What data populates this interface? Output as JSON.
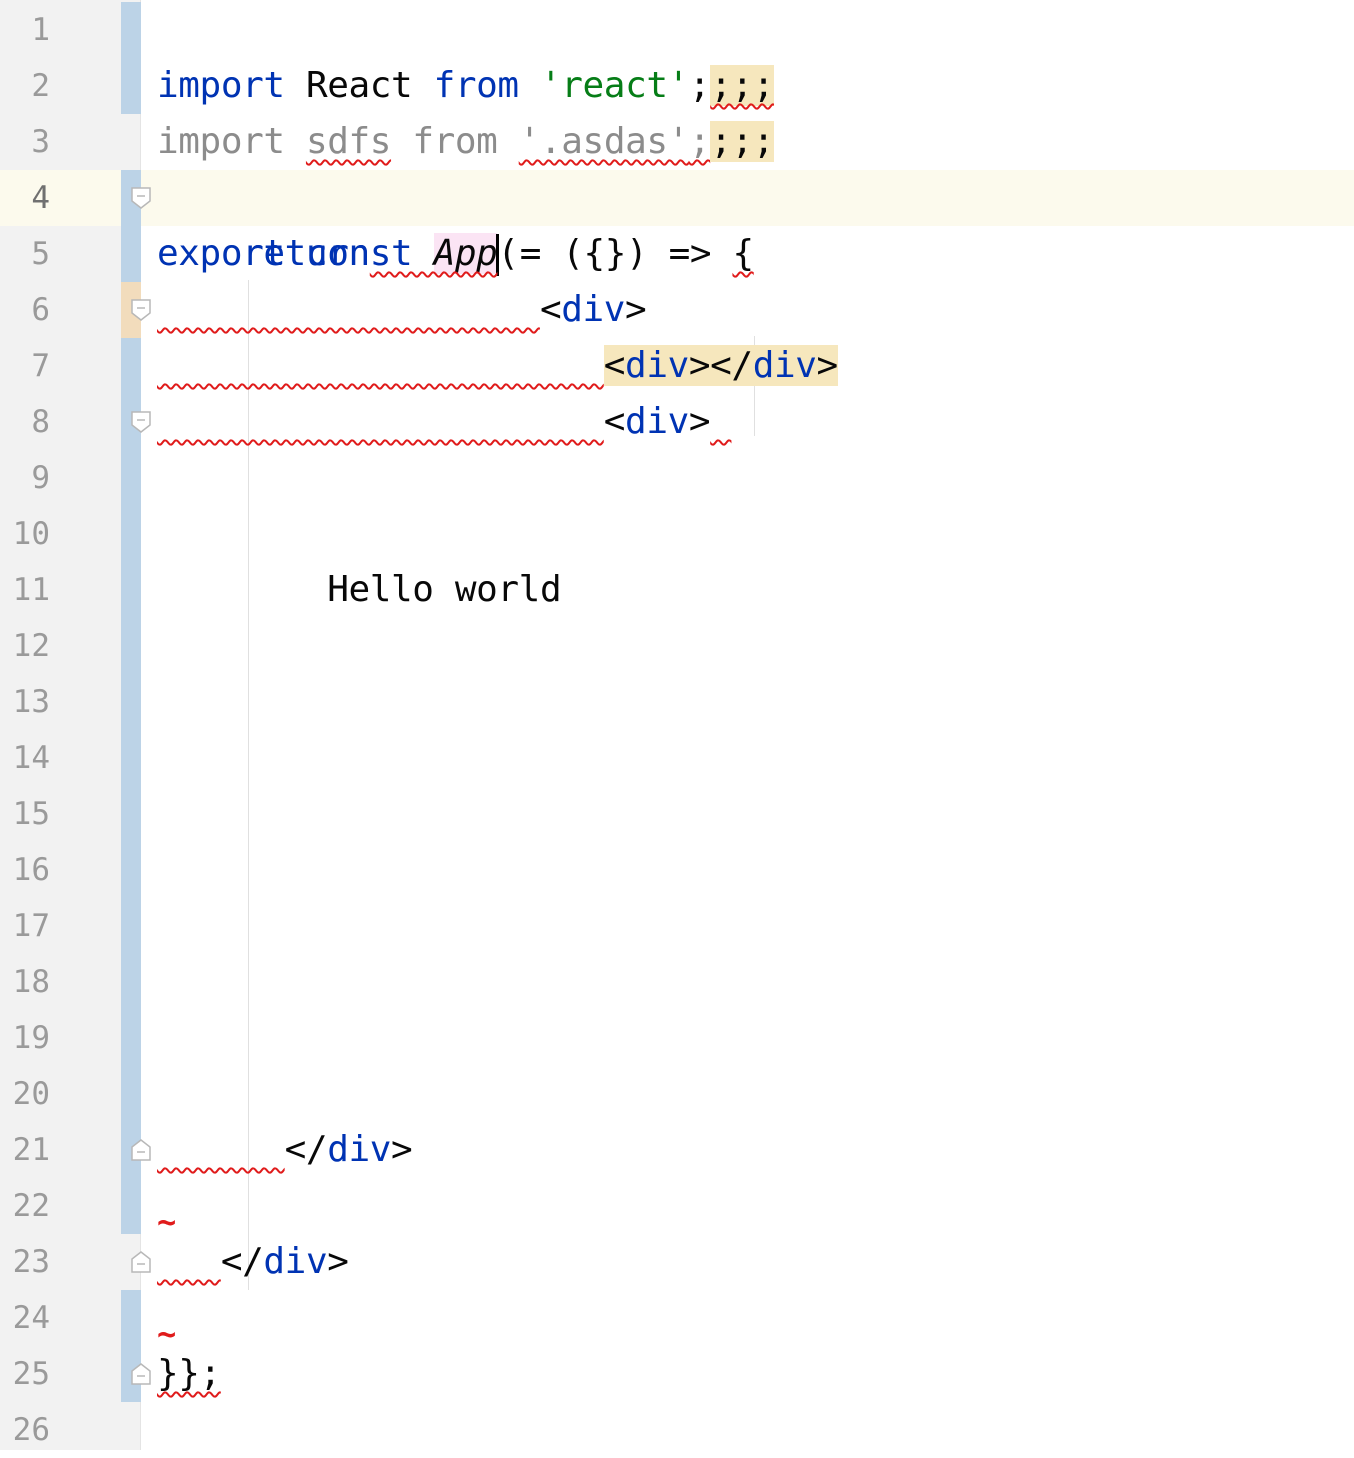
{
  "editor": {
    "caret_line": "4",
    "lines": [
      {
        "n": "1"
      },
      {
        "n": "2"
      },
      {
        "n": "3"
      },
      {
        "n": "4"
      },
      {
        "n": "5"
      },
      {
        "n": "6"
      },
      {
        "n": "7"
      },
      {
        "n": "8"
      },
      {
        "n": "9"
      },
      {
        "n": "10"
      },
      {
        "n": "11"
      },
      {
        "n": "12"
      },
      {
        "n": "13"
      },
      {
        "n": "14"
      },
      {
        "n": "15"
      },
      {
        "n": "16"
      },
      {
        "n": "17"
      },
      {
        "n": "18"
      },
      {
        "n": "19"
      },
      {
        "n": "20"
      },
      {
        "n": "21"
      },
      {
        "n": "22"
      },
      {
        "n": "23"
      },
      {
        "n": "24"
      },
      {
        "n": "25"
      },
      {
        "n": "26"
      }
    ]
  },
  "code": {
    "l1": {
      "kw1": "import",
      "id": "React",
      "kw2": "from",
      "str": "'react'",
      "semi": ";",
      "extra": ";;;"
    },
    "l2": {
      "kw1": "import",
      "id": "sdfs",
      "kw2": "from",
      "str": "'.asdas'",
      "semi": ";",
      "extra": ";;;"
    },
    "l4": {
      "kw1": "export",
      "kw2": "const",
      "name": "App",
      "rest": " = ({}) => ",
      "brace": "{"
    },
    "l5": {
      "kw": "return",
      "paren": "("
    },
    "l6": {
      "lt": "<",
      "tag": "div",
      "gt": ">"
    },
    "l7": {
      "lt": "<",
      "tag1": "div",
      "mid": "></",
      "tag2": "div",
      "gt": ">"
    },
    "l8": {
      "lt": "<",
      "tag": "div",
      "gt": ">"
    },
    "l11": {
      "text": "Hello world"
    },
    "l21": {
      "lt": "</",
      "tag": "div",
      "gt": ">"
    },
    "l23": {
      "lt": "</",
      "tag": "div",
      "gt": ">"
    },
    "l25": {
      "text": "}};"
    },
    "err_tilde": "~"
  },
  "colors": {
    "keyword": "#0033b3",
    "string": "#067d17",
    "error": "#e01b1b",
    "gutter_bg": "#f2f2f2",
    "change_marker": "#bcd3e7",
    "caret_row": "#fcfaed",
    "highlight_yellow": "#f6e7bd",
    "highlight_pink": "#fbe4f4"
  },
  "icons": {
    "fold": "fold-marker-icon",
    "fold_end": "fold-end-icon"
  }
}
